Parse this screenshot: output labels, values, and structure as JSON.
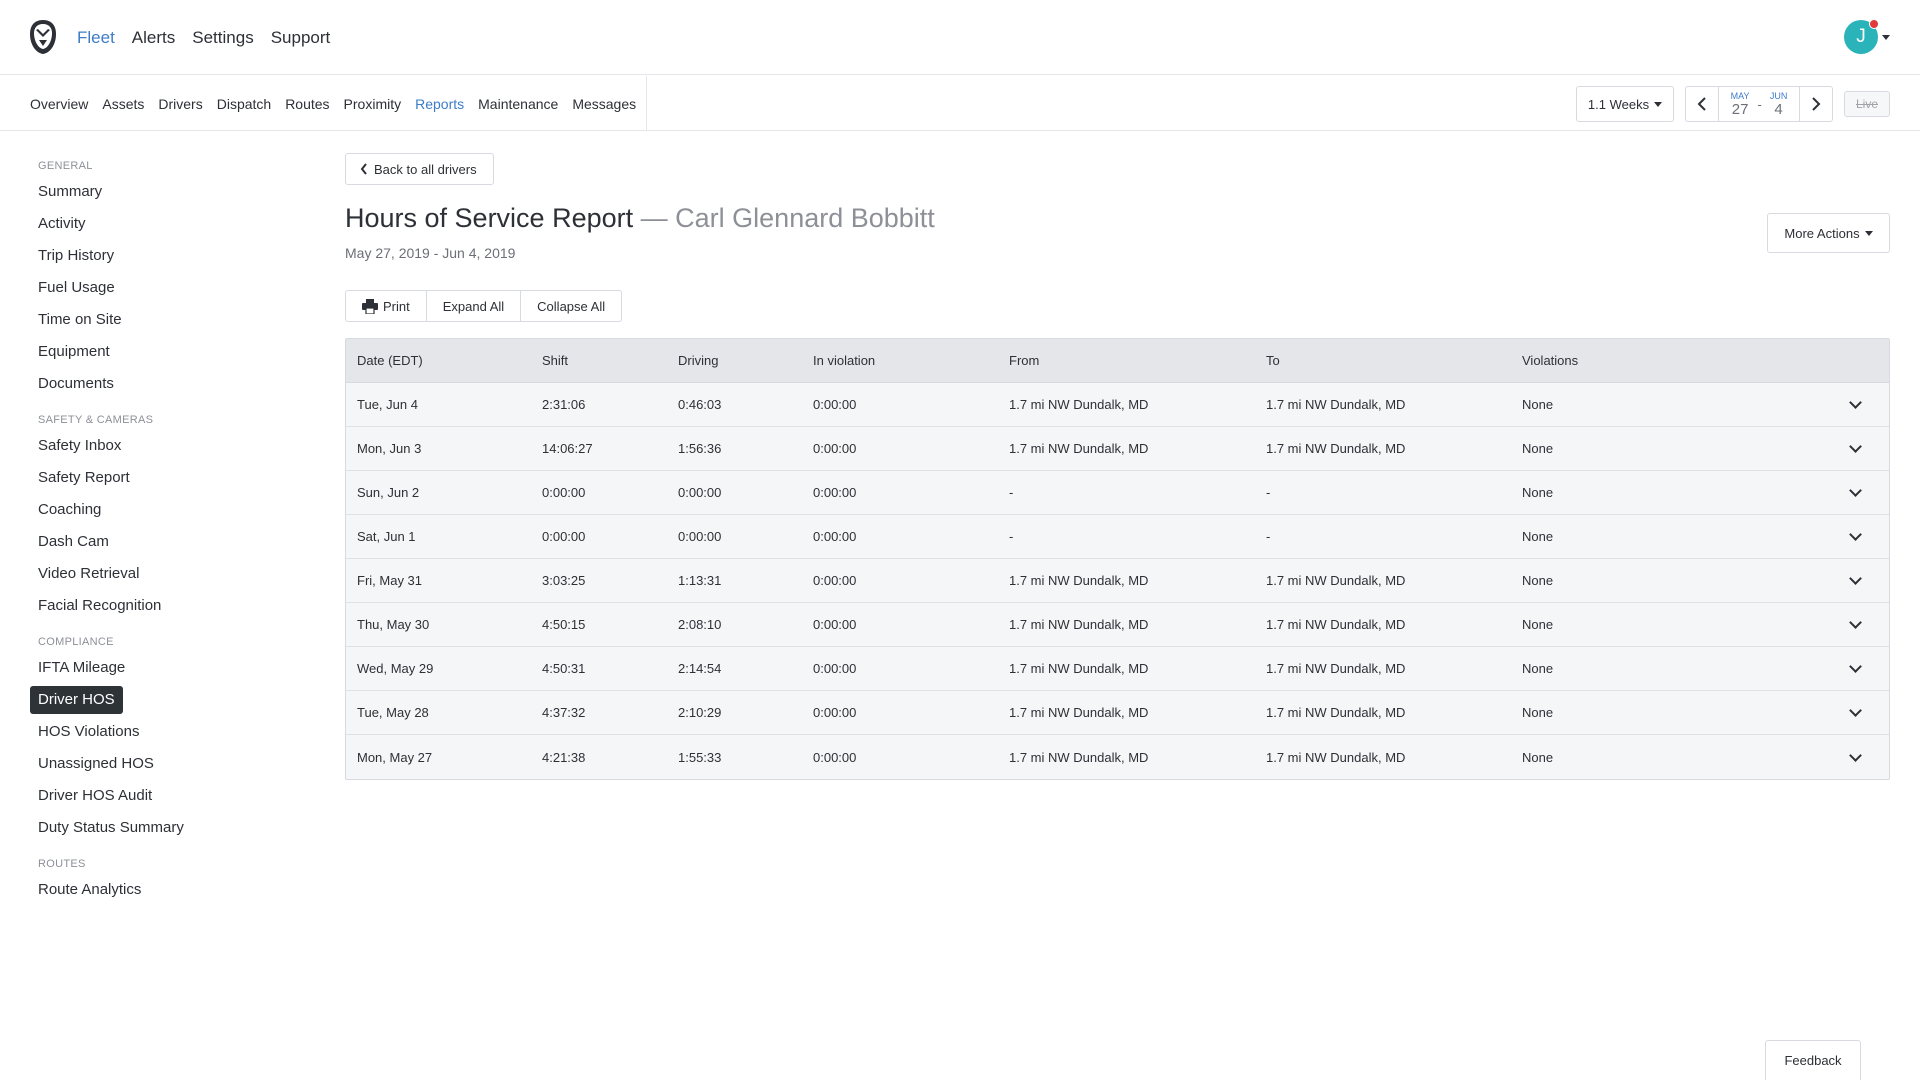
{
  "topnav": {
    "logo_icon": "owl-logo-icon",
    "items": [
      "Fleet",
      "Alerts",
      "Settings",
      "Support"
    ],
    "active": "Fleet",
    "avatar_initial": "J"
  },
  "subnav": {
    "items": [
      "Overview",
      "Assets",
      "Drivers",
      "Dispatch",
      "Routes",
      "Proximity",
      "Reports",
      "Maintenance",
      "Messages"
    ],
    "active": "Reports",
    "range_label": "1.1 Weeks",
    "start_month": "MAY",
    "start_day": "27",
    "end_month": "JUN",
    "end_day": "4",
    "date_separator": "-",
    "live_label": "Live"
  },
  "sidebar": {
    "general_label": "GENERAL",
    "general": [
      "Summary",
      "Activity",
      "Trip History",
      "Fuel Usage",
      "Time on Site",
      "Equipment",
      "Documents"
    ],
    "safety_label": "SAFETY & CAMERAS",
    "safety": [
      "Safety Inbox",
      "Safety Report",
      "Coaching",
      "Dash Cam",
      "Video Retrieval",
      "Facial Recognition"
    ],
    "compliance_label": "COMPLIANCE",
    "compliance": [
      "IFTA Mileage",
      "Driver HOS",
      "HOS Violations",
      "Unassigned HOS",
      "Driver HOS Audit",
      "Duty Status Summary"
    ],
    "routes_label": "ROUTES",
    "routes": [
      "Route Analytics"
    ],
    "active": "Driver HOS"
  },
  "main": {
    "back_label": "Back to all drivers",
    "title": "Hours of Service Report",
    "title_separator": "—",
    "driver_name": "Carl Glennard Bobbitt",
    "date_range": "May 27, 2019 - Jun 4, 2019",
    "more_actions": "More Actions",
    "print_label": "Print",
    "expand_label": "Expand All",
    "collapse_label": "Collapse All"
  },
  "table": {
    "headers": [
      "Date (EDT)",
      "Shift",
      "Driving",
      "In violation",
      "From",
      "To",
      "Violations"
    ],
    "rows": [
      [
        "Tue, Jun 4",
        "2:31:06",
        "0:46:03",
        "0:00:00",
        "1.7 mi NW Dundalk, MD",
        "1.7 mi NW Dundalk, MD",
        "None"
      ],
      [
        "Mon, Jun 3",
        "14:06:27",
        "1:56:36",
        "0:00:00",
        "1.7 mi NW Dundalk, MD",
        "1.7 mi NW Dundalk, MD",
        "None"
      ],
      [
        "Sun, Jun 2",
        "0:00:00",
        "0:00:00",
        "0:00:00",
        "-",
        "-",
        "None"
      ],
      [
        "Sat, Jun 1",
        "0:00:00",
        "0:00:00",
        "0:00:00",
        "-",
        "-",
        "None"
      ],
      [
        "Fri, May 31",
        "3:03:25",
        "1:13:31",
        "0:00:00",
        "1.7 mi NW Dundalk, MD",
        "1.7 mi NW Dundalk, MD",
        "None"
      ],
      [
        "Thu, May 30",
        "4:50:15",
        "2:08:10",
        "0:00:00",
        "1.7 mi NW Dundalk, MD",
        "1.7 mi NW Dundalk, MD",
        "None"
      ],
      [
        "Wed, May 29",
        "4:50:31",
        "2:14:54",
        "0:00:00",
        "1.7 mi NW Dundalk, MD",
        "1.7 mi NW Dundalk, MD",
        "None"
      ],
      [
        "Tue, May 28",
        "4:37:32",
        "2:10:29",
        "0:00:00",
        "1.7 mi NW Dundalk, MD",
        "1.7 mi NW Dundalk, MD",
        "None"
      ],
      [
        "Mon, May 27",
        "4:21:38",
        "1:55:33",
        "0:00:00",
        "1.7 mi NW Dundalk, MD",
        "1.7 mi NW Dundalk, MD",
        "None"
      ]
    ]
  },
  "feedback_label": "Feedback",
  "colors": {
    "accent": "#3d7cc9",
    "avatar": "#2ab3b8",
    "notification": "#e03a3a",
    "sidebar_active_bg": "#2e3338"
  }
}
